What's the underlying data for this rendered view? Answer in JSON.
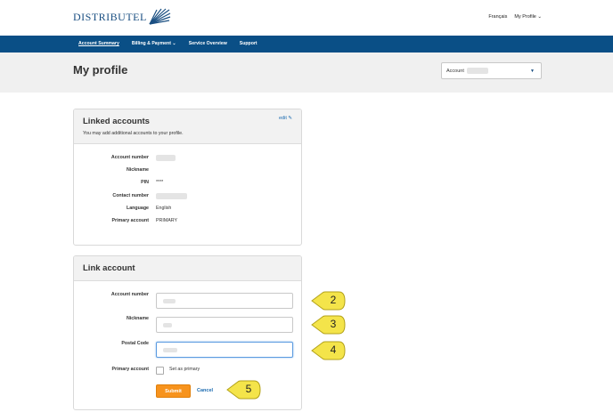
{
  "brand": {
    "name": "DISTRIBUTEL",
    "accent": "#0a4f86",
    "orange": "#f7931d",
    "link": "#1a6ab0"
  },
  "top_links": {
    "language": "Français",
    "profile": "My Profile"
  },
  "nav": [
    {
      "label": "Account Summary",
      "active": true
    },
    {
      "label": "Billing & Payment",
      "has_dropdown": true
    },
    {
      "label": "Service Overview"
    },
    {
      "label": "Support"
    }
  ],
  "page": {
    "title": "My profile",
    "account_select_label": "Account"
  },
  "linked_accounts": {
    "title": "Linked accounts",
    "subtitle": "You may add additional accounts to your profile.",
    "edit_label": "edit",
    "rows": [
      {
        "label": "Account number",
        "value": ""
      },
      {
        "label": "Nickname",
        "value": ""
      },
      {
        "label": "PIN",
        "value": "****"
      },
      {
        "label": "Contact number",
        "value": ""
      },
      {
        "label": "Language",
        "value": "English"
      },
      {
        "label": "Primary account",
        "value": "PRIMARY"
      }
    ]
  },
  "link_account": {
    "title": "Link account",
    "fields": [
      {
        "label": "Account number",
        "value": ""
      },
      {
        "label": "Nickname",
        "value": ""
      },
      {
        "label": "Postal Code",
        "value": ""
      }
    ],
    "primary_label": "Primary account",
    "primary_checkbox_label": "Set as primary",
    "submit_label": "Submit",
    "cancel_label": "Cancel"
  },
  "callouts": [
    "2",
    "3",
    "4",
    "5"
  ]
}
